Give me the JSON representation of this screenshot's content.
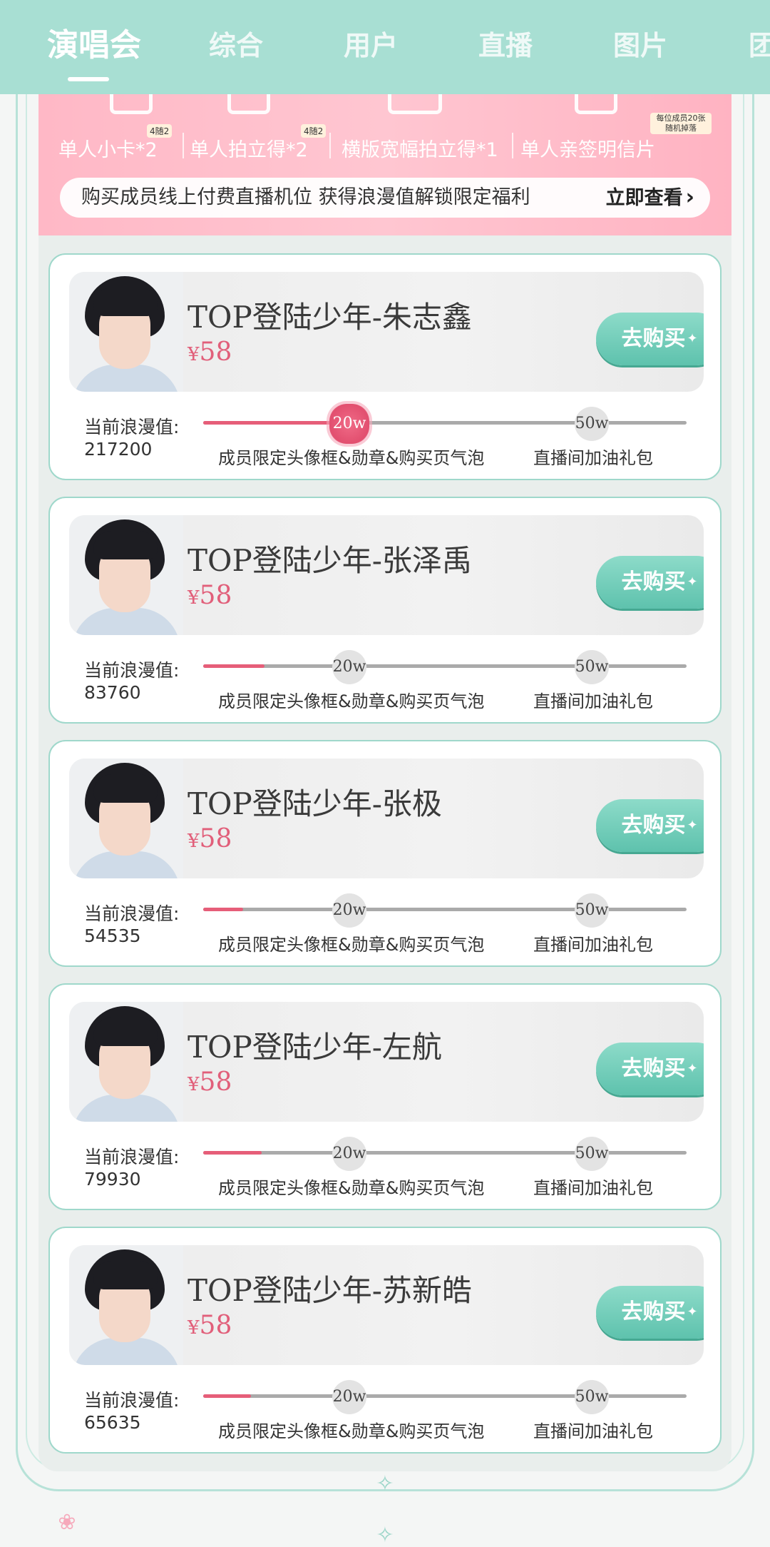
{
  "tabs": [
    {
      "label": "演唱会",
      "active": true
    },
    {
      "label": "综合",
      "active": false
    },
    {
      "label": "用户",
      "active": false
    },
    {
      "label": "直播",
      "active": false
    },
    {
      "label": "图片",
      "active": false
    },
    {
      "label": "团",
      "active": false
    }
  ],
  "banner": {
    "rewards": [
      {
        "label": "单人小卡*2",
        "badge": "4随2"
      },
      {
        "label": "单人拍立得*2",
        "badge": "4随2"
      },
      {
        "label": "横版宽幅拍立得*1",
        "badge": ""
      },
      {
        "label": "单人亲签明信片",
        "badge": "每位成员20张随机掉落"
      }
    ],
    "notice": "购买成员线上付费直播机位 获得浪漫值解锁限定福利",
    "notice_link": "立即查看"
  },
  "progress_labels": {
    "current_label": "当前浪漫值:",
    "milestone_1": "20w",
    "milestone_2": "50w",
    "reward_1": "成员限定头像框&勋章&购买页气泡",
    "reward_2": "直播间加油礼包",
    "max_value": 500000,
    "milestone_1_value": 200000,
    "milestone_2_value": 500000
  },
  "cards": [
    {
      "title": "TOP登陆少年-朱志鑫",
      "currency": "¥",
      "price": "58",
      "buy": "去购买",
      "romance": "217200",
      "romance_value": 217200,
      "reached_1": true
    },
    {
      "title": "TOP登陆少年-张泽禹",
      "currency": "¥",
      "price": "58",
      "buy": "去购买",
      "romance": "83760",
      "romance_value": 83760,
      "reached_1": false
    },
    {
      "title": "TOP登陆少年-张极",
      "currency": "¥",
      "price": "58",
      "buy": "去购买",
      "romance": "54535",
      "romance_value": 54535,
      "reached_1": false
    },
    {
      "title": "TOP登陆少年-左航",
      "currency": "¥",
      "price": "58",
      "buy": "去购买",
      "romance": "79930",
      "romance_value": 79930,
      "reached_1": false
    },
    {
      "title": "TOP登陆少年-苏新皓",
      "currency": "¥",
      "price": "58",
      "buy": "去购买",
      "romance": "65635",
      "romance_value": 65635,
      "reached_1": false
    }
  ],
  "colors": {
    "tabbar": "#a8dfd3",
    "accent_pink": "#e15f7a",
    "button_teal": "#5ec2ad",
    "progress_fill": "#e65e79"
  }
}
